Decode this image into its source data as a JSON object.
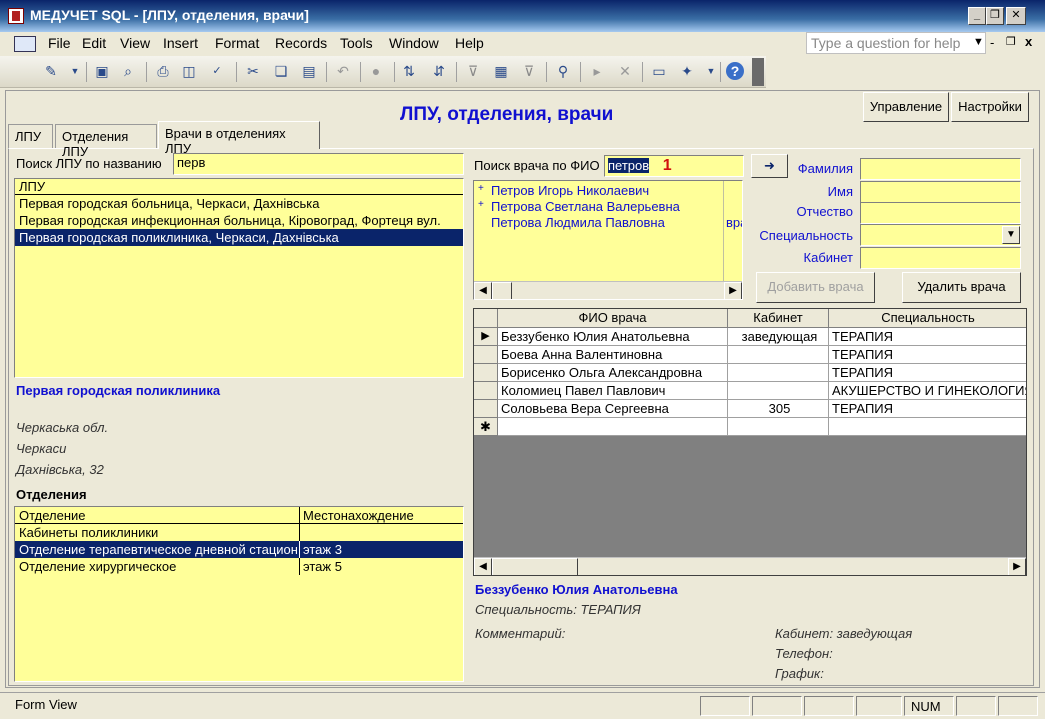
{
  "window": {
    "title": "МЕДУЧЕТ SQL - [ЛПУ, отделения, врачи]",
    "minimize_glyph": "_",
    "restore_glyph": "❐",
    "close_glyph": "✕"
  },
  "menu": {
    "items": [
      "File",
      "Edit",
      "View",
      "Insert",
      "Format",
      "Records",
      "Tools",
      "Window",
      "Help"
    ],
    "help_placeholder": "Type a question for help",
    "doc_controls": [
      "-",
      "❐",
      "x"
    ]
  },
  "form": {
    "title": "ЛПУ, отделения, врачи",
    "buttons": {
      "manage": "Управление",
      "settings": "Настройки"
    },
    "tabs": [
      {
        "label": "ЛПУ"
      },
      {
        "label": "Отделения ЛПУ"
      },
      {
        "label": "Врачи в отделениях ЛПУ"
      }
    ]
  },
  "lpu_search": {
    "label": "Поиск ЛПУ по названию",
    "value": "перв",
    "list_header": "ЛПУ",
    "items": [
      "Первая городская больница, Черкаси, Дахнівська",
      "Первая городская инфекционная больница, Кіровоград, Фортеця вул.",
      "Первая городская поликлиника, Черкаси, Дахнівська"
    ],
    "selected_index": 2
  },
  "lpu_detail": {
    "name": "Первая городская поликлиника",
    "region": "Черкаська обл.",
    "city": "Черкаси",
    "street": "Дахнiвська, 32"
  },
  "departments": {
    "label": "Отделения",
    "columns": [
      "Отделение",
      "Местонахождение"
    ],
    "rows": [
      [
        "Кабинеты поликлиники",
        ""
      ],
      [
        "Отделение терапевтическое дневной стационар",
        "этаж 3"
      ],
      [
        "Отделение хирургическое",
        "этаж 5"
      ]
    ],
    "selected_index": 1
  },
  "doctor_search": {
    "label": "Поиск врача по ФИО",
    "value": "петров",
    "marker": "1",
    "go_arrow": "➜",
    "results": [
      {
        "expander": "+",
        "name": "Петров Игорь Николаевич",
        "extra": ""
      },
      {
        "expander": "+",
        "name": "Петрова Светлана Валерьевна",
        "extra": ""
      },
      {
        "expander": "",
        "name": "Петрова Людмила Павловна",
        "extra": "вра"
      }
    ]
  },
  "new_doctor": {
    "fields": [
      {
        "label": "Фамилия",
        "value": ""
      },
      {
        "label": "Имя",
        "value": ""
      },
      {
        "label": "Отчество",
        "value": ""
      },
      {
        "label": "Специальность",
        "value": ""
      },
      {
        "label": "Кабинет",
        "value": ""
      }
    ],
    "add_button": "Добавить врача",
    "delete_button": "Удалить врача"
  },
  "doctors_grid": {
    "columns": [
      "ФИО врача",
      "Кабинет",
      "Специальность"
    ],
    "rows": [
      [
        "Беззубенко Юлия Анатольевна",
        "заведующая",
        "ТЕРАПИЯ"
      ],
      [
        "Боева Анна Валентиновна",
        "",
        "ТЕРАПИЯ"
      ],
      [
        "Борисенко Ольга Александровна",
        "",
        "ТЕРАПИЯ"
      ],
      [
        "Коломиец Павел Павлович",
        "",
        "АКУШЕРСТВО И ГИНЕКОЛОГИЯ"
      ],
      [
        "Соловьева Вера Сергеевна",
        "305",
        "ТЕРАПИЯ"
      ]
    ],
    "current_row_marker": "▶",
    "new_row_marker": "✱"
  },
  "doctor_detail": {
    "name": "Беззубенко Юлия Анатольевна",
    "specialty": "Специальность: ТЕРАПИЯ",
    "comment": "Комментарий:",
    "cabinet": "Кабинет: заведующая",
    "phone": "Телефон:",
    "schedule": "График:"
  },
  "status": {
    "view": "Form View",
    "num": "NUM"
  }
}
